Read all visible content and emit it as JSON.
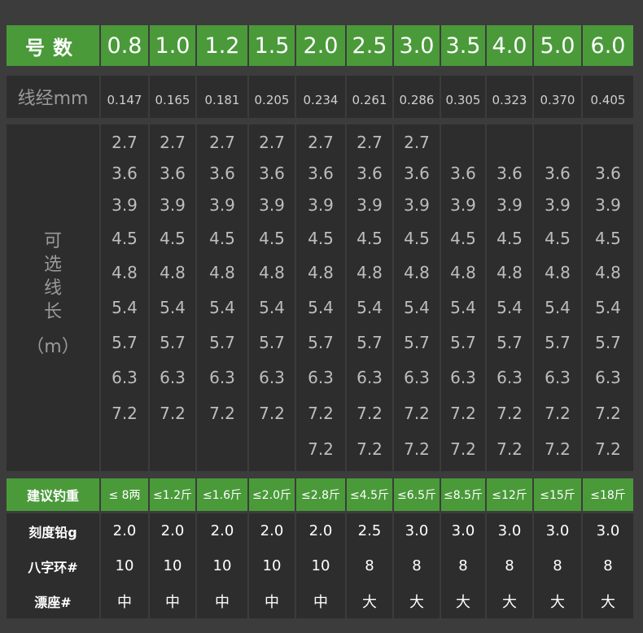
{
  "chart_data": {
    "type": "table",
    "header": {
      "label": "号数",
      "sizes": [
        "0.8",
        "1.0",
        "1.2",
        "1.5",
        "2.0",
        "2.5",
        "3.0",
        "3.5",
        "4.0",
        "5.0",
        "6.0"
      ]
    },
    "diameter": {
      "label": "线经mm",
      "values": [
        "0.147",
        "0.165",
        "0.181",
        "0.205",
        "0.234",
        "0.261",
        "0.286",
        "0.305",
        "0.323",
        "0.370",
        "0.405"
      ]
    },
    "lengths": {
      "label_chars": [
        "可",
        "选",
        "线",
        "长"
      ],
      "unit": "（m）",
      "columns": [
        [
          "2.7",
          "3.6",
          "3.9",
          "4.5",
          "4.8",
          "5.4",
          "5.7",
          "6.3",
          "7.2",
          ""
        ],
        [
          "2.7",
          "3.6",
          "3.9",
          "4.5",
          "4.8",
          "5.4",
          "5.7",
          "6.3",
          "7.2",
          ""
        ],
        [
          "2.7",
          "3.6",
          "3.9",
          "4.5",
          "4.8",
          "5.4",
          "5.7",
          "6.3",
          "7.2",
          ""
        ],
        [
          "2.7",
          "3.6",
          "3.9",
          "4.5",
          "4.8",
          "5.4",
          "5.7",
          "6.3",
          "7.2",
          ""
        ],
        [
          "2.7",
          "3.6",
          "3.9",
          "4.5",
          "4.8",
          "5.4",
          "5.7",
          "6.3",
          "7.2",
          "7.2"
        ],
        [
          "2.7",
          "3.6",
          "3.9",
          "4.5",
          "4.8",
          "5.4",
          "5.7",
          "6.3",
          "7.2",
          "7.2"
        ],
        [
          "2.7",
          "3.6",
          "3.9",
          "4.5",
          "4.8",
          "5.4",
          "5.7",
          "6.3",
          "7.2",
          "7.2"
        ],
        [
          "",
          "3.6",
          "3.9",
          "4.5",
          "4.8",
          "5.4",
          "5.7",
          "6.3",
          "7.2",
          "7.2"
        ],
        [
          "",
          "3.6",
          "3.9",
          "4.5",
          "4.8",
          "5.4",
          "5.7",
          "6.3",
          "7.2",
          "7.2"
        ],
        [
          "",
          "3.6",
          "3.9",
          "4.5",
          "4.8",
          "5.4",
          "5.7",
          "6.3",
          "7.2",
          "7.2"
        ],
        [
          "",
          "3.6",
          "3.9",
          "4.5",
          "4.8",
          "5.4",
          "5.7",
          "6.3",
          "7.2",
          "7.2"
        ]
      ]
    },
    "rod_weight": {
      "label": "建议钓重",
      "values": [
        "≤ 8两",
        "≤1.2斤",
        "≤1.6斤",
        "≤2.0斤",
        "≤2.8斤",
        "≤4.5斤",
        "≤6.5斤",
        "≤8.5斤",
        "≤12斤",
        "≤15斤",
        "≤18斤"
      ]
    },
    "lead": {
      "label": "刻度铅g",
      "values": [
        "2.0",
        "2.0",
        "2.0",
        "2.0",
        "2.0",
        "2.5",
        "3.0",
        "3.0",
        "3.0",
        "3.0",
        "3.0"
      ]
    },
    "ring": {
      "label": "八字环#",
      "values": [
        "10",
        "10",
        "10",
        "10",
        "10",
        "8",
        "8",
        "8",
        "8",
        "8",
        "8"
      ]
    },
    "float_seat": {
      "label": "漂座#",
      "values": [
        "中",
        "中",
        "中",
        "中",
        "中",
        "大",
        "大",
        "大",
        "大",
        "大",
        "大"
      ]
    }
  }
}
